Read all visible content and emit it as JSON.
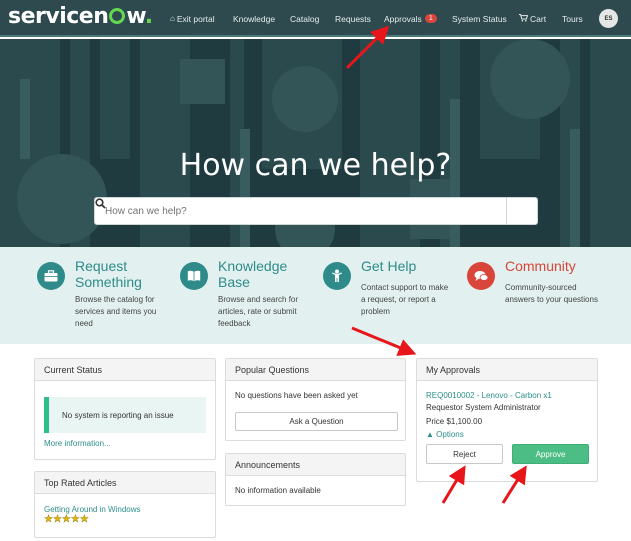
{
  "header": {
    "logo_text": "servicenow.",
    "nav": [
      {
        "id": "exit",
        "label": "Exit portal",
        "icon": "home-icon"
      },
      {
        "id": "knowledge",
        "label": "Knowledge"
      },
      {
        "id": "catalog",
        "label": "Catalog"
      },
      {
        "id": "requests",
        "label": "Requests"
      },
      {
        "id": "approvals",
        "label": "Approvals",
        "badge": "1"
      },
      {
        "id": "status",
        "label": "System Status"
      },
      {
        "id": "cart",
        "label": "Cart",
        "icon": "cart-icon"
      },
      {
        "id": "tours",
        "label": "Tours"
      }
    ],
    "avatar_initials": "ES"
  },
  "hero": {
    "title": "How can we help?",
    "search_placeholder": "How can we help?"
  },
  "quick_links": [
    {
      "title_line1": "Request",
      "title_line2": "Something",
      "desc": [
        "Browse the catalog for",
        "services and items you",
        "need"
      ],
      "icon": "briefcase-icon",
      "color": "#2e8b8a"
    },
    {
      "title_line1": "Knowledge",
      "title_line2": "Base",
      "desc": [
        "Browse and search for",
        "articles, rate or submit",
        "feedback"
      ],
      "icon": "book-icon",
      "color": "#2e8b8a"
    },
    {
      "title_line1": "Get Help",
      "title_line2": "",
      "desc": [
        "Contact support to make",
        "a request, or report a",
        "problem"
      ],
      "icon": "person-icon",
      "color": "#2e8b8a"
    },
    {
      "title_line1": "Community",
      "title_line2": "",
      "desc": [
        "Community-sourced",
        "answers to your questions"
      ],
      "icon": "chat-icon",
      "color": "#d9453a"
    }
  ],
  "current_status": {
    "title": "Current Status",
    "message": "No system is reporting an issue",
    "more_link": "More information..."
  },
  "top_rated": {
    "title": "Top Rated Articles",
    "article": "Getting Around in Windows",
    "stars": "★★★★★"
  },
  "popular_questions": {
    "title": "Popular Questions",
    "empty_text": "No questions have been asked yet",
    "ask_button": "Ask a Question"
  },
  "announcements": {
    "title": "Announcements",
    "empty_text": "No information available"
  },
  "my_approvals": {
    "title": "My Approvals",
    "request_link": "REQ0010002 - Lenovo - Carbon x1",
    "requestor": "Requestor System Administrator",
    "price": "Price $1,100.00",
    "options_label": "Options",
    "reject_label": "Reject",
    "approve_label": "Approve"
  },
  "colors": {
    "header_bg": "#2e4a4f",
    "hero_bg": "#1f3b3f",
    "accent_green": "#62d84e",
    "link_teal": "#2b8f8a",
    "approve_green": "#4cbd84",
    "alert_red": "#d9453a",
    "annotation_red": "#e8161a"
  }
}
